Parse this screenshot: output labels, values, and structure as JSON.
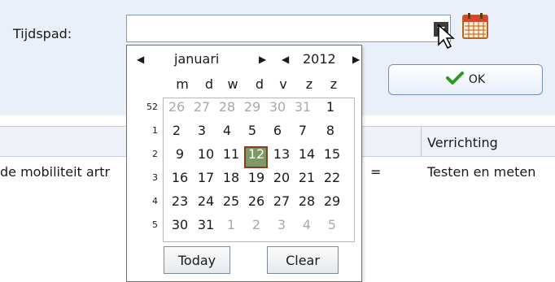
{
  "form": {
    "tijdspad_label": "Tijdspad:",
    "combo_value": "",
    "ok_label": "OK"
  },
  "table": {
    "column_header": "Verrichting",
    "row1": {
      "col1": "de mobiliteit artr",
      "col2": "=",
      "col3": "Testen en meten"
    }
  },
  "calendar": {
    "month": "januari",
    "year": "2012",
    "weekday_headers": [
      "m",
      "d",
      "w",
      "d",
      "v",
      "z",
      "z"
    ],
    "week_numbers": [
      "52",
      "1",
      "2",
      "3",
      "4",
      "5"
    ],
    "weeks": [
      [
        "26",
        "27",
        "28",
        "29",
        "30",
        "31",
        "1"
      ],
      [
        "2",
        "3",
        "4",
        "5",
        "6",
        "7",
        "8"
      ],
      [
        "9",
        "10",
        "11",
        "12",
        "13",
        "14",
        "15"
      ],
      [
        "16",
        "17",
        "18",
        "19",
        "20",
        "21",
        "22"
      ],
      [
        "23",
        "24",
        "25",
        "26",
        "27",
        "28",
        "29"
      ],
      [
        "30",
        "31",
        "1",
        "2",
        "3",
        "4",
        "5"
      ]
    ],
    "selected_day": "12",
    "today_label": "Today",
    "clear_label": "Clear"
  },
  "colors": {
    "panel_background": "#eaf0f9",
    "selected_day_fill": "#7d9a64",
    "selected_day_border": "#8a3b2a",
    "other_month_text": "#a9a9a9"
  }
}
